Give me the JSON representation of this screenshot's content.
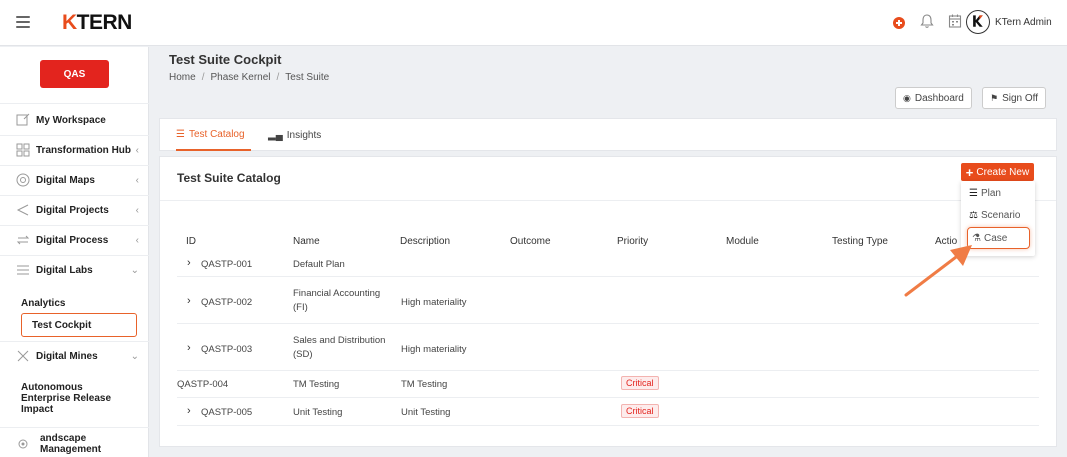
{
  "topbar": {
    "brand": "TERN",
    "brand_k": "K",
    "user_name": "KTern Admin"
  },
  "sidebar": {
    "badge": "QAS",
    "items": [
      {
        "label": "My Workspace",
        "icon": "workspace-icon"
      },
      {
        "label": "Transformation Hub",
        "icon": "grid-icon"
      },
      {
        "label": "Digital Maps",
        "icon": "map-icon"
      },
      {
        "label": "Digital Projects",
        "icon": "send-icon"
      },
      {
        "label": "Digital Process",
        "icon": "process-icon"
      },
      {
        "label": "Digital Labs",
        "icon": "list-icon"
      },
      {
        "label": "Digital Mines",
        "icon": "mines-icon"
      },
      {
        "label": "andscape Management",
        "icon": "gear-icon"
      }
    ],
    "labs_sub": [
      "Analytics",
      "Test Cockpit"
    ],
    "mines_sub": "Autonomous Enterprise Release Impact"
  },
  "header": {
    "title": "Test Suite Cockpit",
    "breadcrumb": [
      "Home",
      "Phase Kernel",
      "Test Suite"
    ],
    "dashboard_label": "Dashboard",
    "signoff_label": "Sign Off"
  },
  "tabs": [
    {
      "label": "Test Catalog",
      "active": true
    },
    {
      "label": "Insights",
      "active": false
    }
  ],
  "catalog": {
    "title": "Test Suite Catalog",
    "create_label": "Create New",
    "columns": [
      "ID",
      "Name",
      "Description",
      "Outcome",
      "Priority",
      "Module",
      "Testing Type",
      "Actio"
    ],
    "rows": [
      {
        "id": "QASTP-001",
        "name": "Default Plan",
        "description": "",
        "priority": "",
        "expandable": true
      },
      {
        "id": "QASTP-002",
        "name": "Financial Accounting (FI)",
        "description": "High materiality",
        "priority": "",
        "expandable": true
      },
      {
        "id": "QASTP-003",
        "name": "Sales and Distribution (SD)",
        "description": "High materiality",
        "priority": "",
        "expandable": true
      },
      {
        "id": "QASTP-004",
        "name": "TM Testing",
        "description": "TM Testing",
        "priority": "Critical",
        "expandable": false
      },
      {
        "id": "QASTP-005",
        "name": "Unit Testing",
        "description": "Unit Testing",
        "priority": "Critical",
        "expandable": true
      }
    ]
  },
  "dropdown": {
    "items": [
      "Plan",
      "Scenario",
      "Case"
    ]
  },
  "colors": {
    "accent": "#e84c1c",
    "badge": "#e3241e"
  }
}
